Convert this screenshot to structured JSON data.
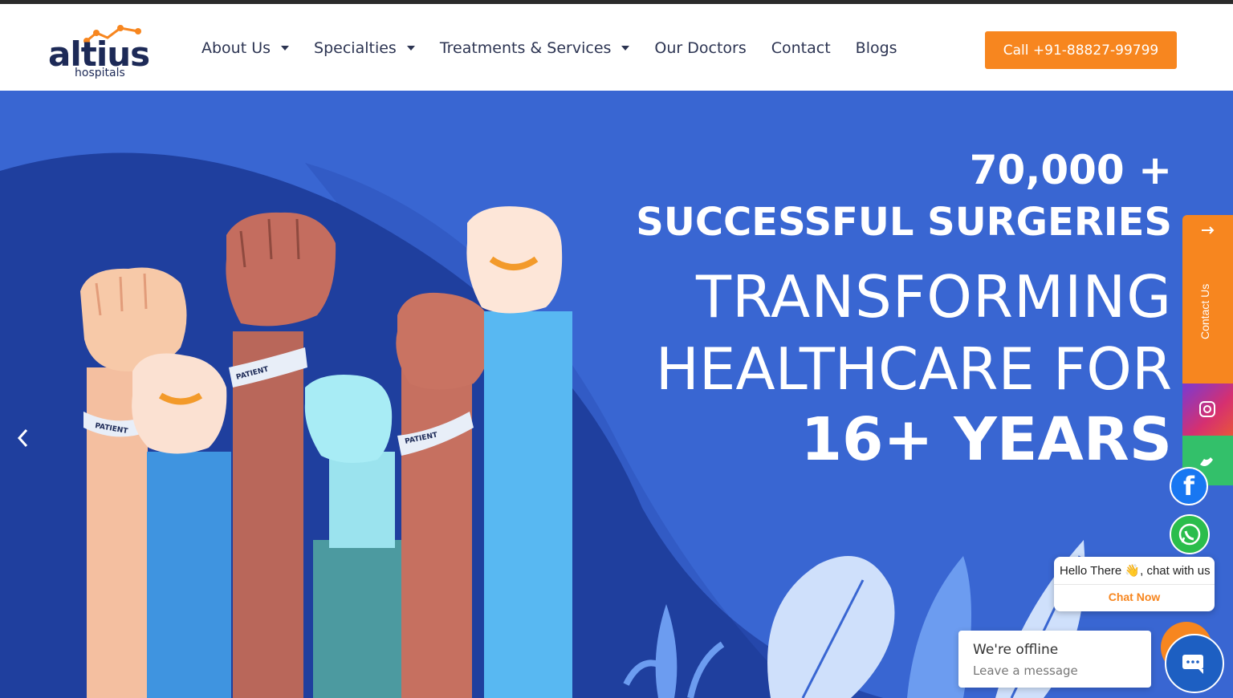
{
  "brand": {
    "name": "altius",
    "sub": "hospitals",
    "accent": "#f7861f",
    "navy": "#1d2a57"
  },
  "nav": {
    "items": [
      {
        "label": "About Us",
        "dropdown": true
      },
      {
        "label": "Specialties",
        "dropdown": true
      },
      {
        "label": "Treatments & Services",
        "dropdown": true
      },
      {
        "label": "Our Doctors",
        "dropdown": false
      },
      {
        "label": "Contact",
        "dropdown": false
      },
      {
        "label": "Blogs",
        "dropdown": false
      }
    ],
    "call_label": "Call +91-88827-99799"
  },
  "hero": {
    "line1": "70,000 +",
    "line2": "SUCCESSFUL SURGERIES",
    "line3": "TRANSFORMING",
    "line4": "HEALTHCARE FOR",
    "line5": "16+ YEARS",
    "wristband_text": "PATIENT",
    "background": "#3966d2"
  },
  "side": {
    "contact_label": "Contact Us"
  },
  "chat": {
    "hello": "Hello There 👋, chat with us",
    "cta": "Chat Now",
    "offline_title": "We're offline",
    "offline_sub": "Leave a message"
  },
  "icons": {
    "prev": "chevron-left-icon",
    "facebook": "facebook-icon",
    "whatsapp": "whatsapp-icon",
    "instagram": "instagram-icon",
    "phone": "phone-icon",
    "chat": "chat-icon"
  }
}
